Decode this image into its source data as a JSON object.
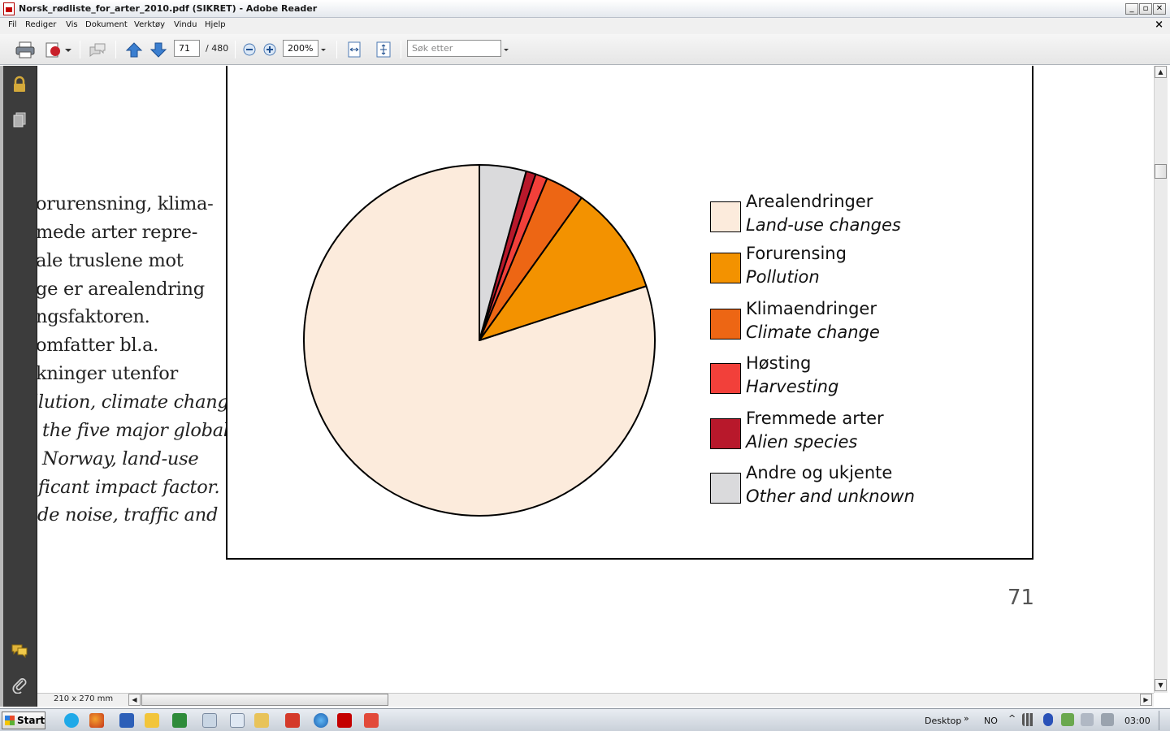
{
  "window": {
    "title": "Norsk_rødliste_for_arter_2010.pdf (SIKRET) - Adobe Reader",
    "controls": {
      "minimize": "_",
      "restore": "▫",
      "close": "✕"
    }
  },
  "menu": {
    "items": [
      "Fil",
      "Rediger",
      "Vis",
      "Dokument",
      "Verktøy",
      "Vindu",
      "Hjelp"
    ],
    "close_doc": "×"
  },
  "toolbar": {
    "page_current": "71",
    "page_total": "/ 480",
    "zoom": "200%",
    "search_placeholder": "Søk etter"
  },
  "document": {
    "body_lines": [
      "orurensning, klima-",
      "mede arter repre-",
      "ale truslene mot",
      "ge er arealendring",
      "ngsfaktoren.",
      "omfatter bl.a.",
      "kninger utenfor"
    ],
    "body_lines_italic": [
      "llution, climate change,",
      "the five major global",
      "Norway, land-use",
      "ificant impact factor.",
      "de noise, traffic and"
    ],
    "page_number": "71",
    "page_size": "210 x 270 mm"
  },
  "chart_data": {
    "type": "pie",
    "start_angle_deg": 0,
    "direction": "counterclockwise",
    "slices": [
      {
        "no": "Arealendringer",
        "en": "Land-use changes",
        "value": 80.0,
        "color": "#fcebdc"
      },
      {
        "no": "Forurensing",
        "en": "Pollution",
        "value": 10.1,
        "color": "#f39200"
      },
      {
        "no": "Klimaendringer",
        "en": "Climate change",
        "value": 3.6,
        "color": "#ed6614"
      },
      {
        "no": "Høsting",
        "en": "Harvesting",
        "value": 1.1,
        "color": "#f2403a"
      },
      {
        "no": "Fremmede arter",
        "en": "Alien species",
        "value": 0.9,
        "color": "#b8182b"
      },
      {
        "no": "Andre og ukjente",
        "en": "Other and unknown",
        "value": 4.3,
        "color": "#dadadc"
      }
    ]
  },
  "taskbar": {
    "start": "Start",
    "desktop": "Desktop",
    "language": "NO",
    "clock": "03:00"
  }
}
